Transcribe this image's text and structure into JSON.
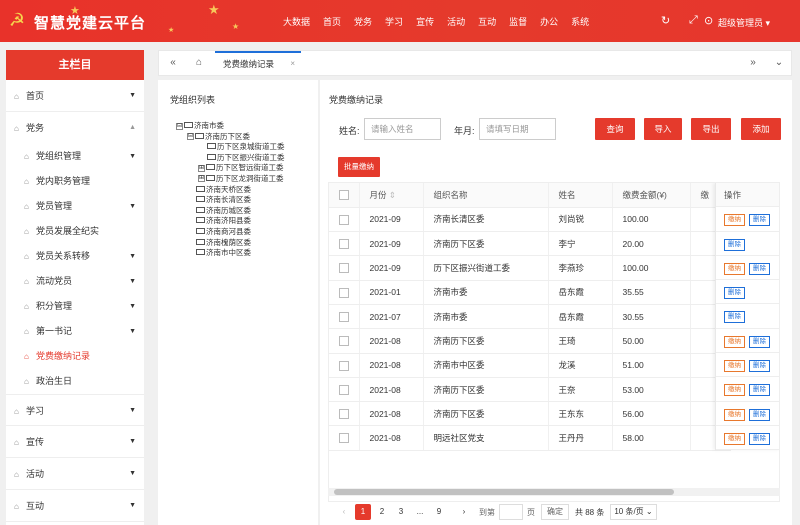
{
  "header": {
    "title": "智慧党建云平台",
    "nav": [
      "大数据",
      "首页",
      "党务",
      "学习",
      "宣传",
      "活动",
      "互动",
      "监督",
      "办公",
      "系统"
    ],
    "user": "超级管理员 ▾",
    "icons": {
      "refresh": "↻",
      "fullscreen": "⤢",
      "lock": "⊙"
    },
    "accent": "#e53a2c"
  },
  "sidebar": {
    "header": "主栏目",
    "items": [
      {
        "label": "首页",
        "level": "top"
      },
      {
        "label": "党务",
        "level": "top",
        "expanded": true
      },
      {
        "label": "党组织管理",
        "level": "sub",
        "arrow": true
      },
      {
        "label": "党内职务管理",
        "level": "sub"
      },
      {
        "label": "党员管理",
        "level": "sub",
        "arrow": true
      },
      {
        "label": "党员发展全纪实",
        "level": "sub"
      },
      {
        "label": "党员关系转移",
        "level": "sub",
        "arrow": true
      },
      {
        "label": "流动党员",
        "level": "sub",
        "arrow": true
      },
      {
        "label": "积分管理",
        "level": "sub",
        "arrow": true
      },
      {
        "label": "第一书记",
        "level": "sub",
        "arrow": true
      },
      {
        "label": "党费缴纳记录",
        "level": "sub",
        "active": true
      },
      {
        "label": "政治生日",
        "level": "sub"
      },
      {
        "label": "学习",
        "level": "top"
      },
      {
        "label": "宣传",
        "level": "top"
      },
      {
        "label": "活动",
        "level": "top"
      },
      {
        "label": "互动",
        "level": "top"
      }
    ]
  },
  "tabbar": {
    "tab": "党费缴纳记录",
    "close": "×",
    "left": "«",
    "home": "⌂",
    "right": "»",
    "down": "⌄"
  },
  "tree": {
    "title": "党组织列表",
    "nodes": [
      {
        "label": "济南市委",
        "depth": 0,
        "toggle": "⊟"
      },
      {
        "label": "济南历下区委",
        "depth": 1,
        "toggle": "⊟"
      },
      {
        "label": "历下区泉城街道工委",
        "depth": 2,
        "toggle": ""
      },
      {
        "label": "历下区振兴街道工委",
        "depth": 2,
        "toggle": ""
      },
      {
        "label": "历下区智远街道工委",
        "depth": 2,
        "toggle": "⊞"
      },
      {
        "label": "历下区龙洞街道工委",
        "depth": 2,
        "toggle": "⊞"
      },
      {
        "label": "济南天桥区委",
        "depth": 1,
        "toggle": ""
      },
      {
        "label": "济南长清区委",
        "depth": 1,
        "toggle": ""
      },
      {
        "label": "济南历城区委",
        "depth": 1,
        "toggle": ""
      },
      {
        "label": "济南济阳县委",
        "depth": 1,
        "toggle": ""
      },
      {
        "label": "济南商河县委",
        "depth": 1,
        "toggle": ""
      },
      {
        "label": "济南槐荫区委",
        "depth": 1,
        "toggle": ""
      },
      {
        "label": "济南市中区委",
        "depth": 1,
        "toggle": ""
      }
    ]
  },
  "main": {
    "title": "党费缴纳记录",
    "search": {
      "name_label": "姓名:",
      "name_placeholder": "请输入姓名",
      "date_label": "年月:",
      "date_placeholder": "请填写日期"
    },
    "buttons": {
      "query": "查询",
      "import": "导入",
      "export": "导出",
      "add": "添加",
      "batch": "批量缴纳"
    },
    "table": {
      "headers": [
        "月份",
        "组织名称",
        "姓名",
        "缴费金额(¥)",
        "缴"
      ],
      "sort_icon": "⇕",
      "ops_header": "操作",
      "pay_label": "缴纳",
      "del_label": "删除",
      "rows": [
        {
          "month": "2021-09",
          "org": "济南长清区委",
          "name": "刘尚锐",
          "amount": "100.00",
          "pay": true
        },
        {
          "month": "2021-09",
          "org": "济南历下区委",
          "name": "李宁",
          "amount": "20.00",
          "pay": false
        },
        {
          "month": "2021-09",
          "org": "历下区振兴街道工委",
          "name": "李燕珍",
          "amount": "100.00",
          "pay": true
        },
        {
          "month": "2021-01",
          "org": "济南市委",
          "name": "岳东霞",
          "amount": "35.55",
          "pay": false
        },
        {
          "month": "2021-07",
          "org": "济南市委",
          "name": "岳东霞",
          "amount": "30.55",
          "pay": false
        },
        {
          "month": "2021-08",
          "org": "济南历下区委",
          "name": "王琦",
          "amount": "50.00",
          "pay": true
        },
        {
          "month": "2021-08",
          "org": "济南市中区委",
          "name": "龙溪",
          "amount": "51.00",
          "pay": true
        },
        {
          "month": "2021-08",
          "org": "济南历下区委",
          "name": "王奈",
          "amount": "53.00",
          "pay": true
        },
        {
          "month": "2021-08",
          "org": "济南历下区委",
          "name": "王东东",
          "amount": "56.00",
          "pay": true
        },
        {
          "month": "2021-08",
          "org": "明远社区党支",
          "name": "王丹丹",
          "amount": "58.00",
          "pay": true
        }
      ]
    },
    "pager": {
      "prev": "‹",
      "pages": [
        "1",
        "2",
        "3",
        "...",
        "9"
      ],
      "current": "1",
      "next": "›",
      "goto_label": "到第",
      "page_unit": "页",
      "confirm": "确定",
      "total": "共 88 条",
      "page_size": "10 条/页 ⌄"
    }
  }
}
